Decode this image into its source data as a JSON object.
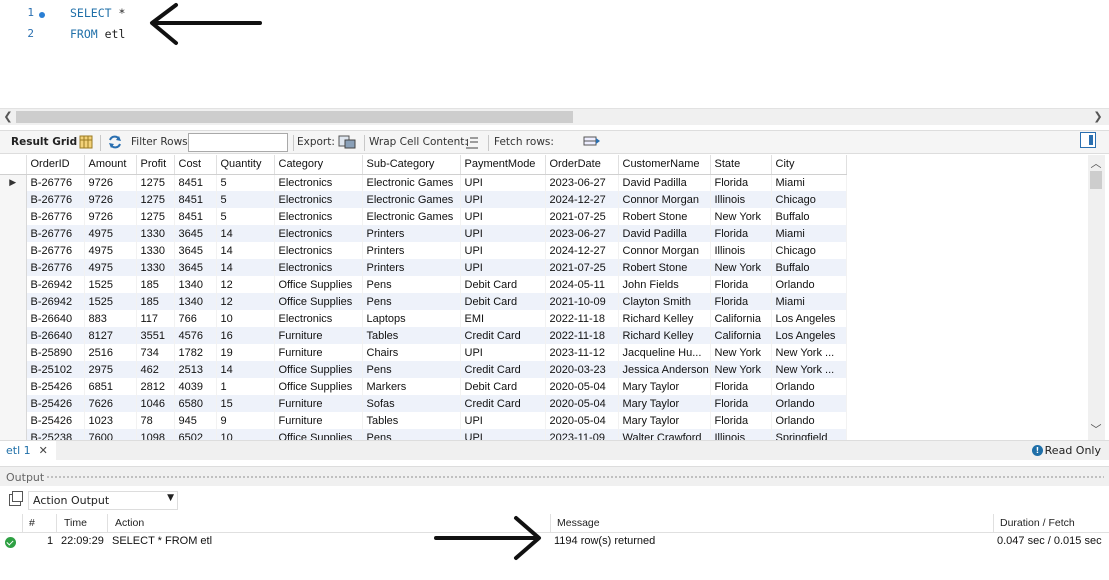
{
  "editor": {
    "lines": [
      {
        "num": "1",
        "keyword": "SELECT",
        "rest": " *"
      },
      {
        "num": "2",
        "keyword": "FROM",
        "rest": " etl"
      }
    ]
  },
  "toolbar": {
    "result_grid": "Result Grid",
    "filter_rows": "Filter Rows:",
    "filter_value": "",
    "export": "Export:",
    "wrap_cell": "Wrap Cell Content:",
    "fetch_rows": "Fetch rows:"
  },
  "grid": {
    "columns": [
      "OrderID",
      "Amount",
      "Profit",
      "Cost",
      "Quantity",
      "Category",
      "Sub-Category",
      "PaymentMode",
      "OrderDate",
      "CustomerName",
      "State",
      "City"
    ],
    "rows": [
      [
        "B-26776",
        "9726",
        "1275",
        "8451",
        "5",
        "Electronics",
        "Electronic Games",
        "UPI",
        "2023-06-27",
        "David Padilla",
        "Florida",
        "Miami"
      ],
      [
        "B-26776",
        "9726",
        "1275",
        "8451",
        "5",
        "Electronics",
        "Electronic Games",
        "UPI",
        "2024-12-27",
        "Connor Morgan",
        "Illinois",
        "Chicago"
      ],
      [
        "B-26776",
        "9726",
        "1275",
        "8451",
        "5",
        "Electronics",
        "Electronic Games",
        "UPI",
        "2021-07-25",
        "Robert Stone",
        "New York",
        "Buffalo"
      ],
      [
        "B-26776",
        "4975",
        "1330",
        "3645",
        "14",
        "Electronics",
        "Printers",
        "UPI",
        "2023-06-27",
        "David Padilla",
        "Florida",
        "Miami"
      ],
      [
        "B-26776",
        "4975",
        "1330",
        "3645",
        "14",
        "Electronics",
        "Printers",
        "UPI",
        "2024-12-27",
        "Connor Morgan",
        "Illinois",
        "Chicago"
      ],
      [
        "B-26776",
        "4975",
        "1330",
        "3645",
        "14",
        "Electronics",
        "Printers",
        "UPI",
        "2021-07-25",
        "Robert Stone",
        "New York",
        "Buffalo"
      ],
      [
        "B-26942",
        "1525",
        "185",
        "1340",
        "12",
        "Office Supplies",
        "Pens",
        "Debit Card",
        "2024-05-11",
        "John Fields",
        "Florida",
        "Orlando"
      ],
      [
        "B-26942",
        "1525",
        "185",
        "1340",
        "12",
        "Office Supplies",
        "Pens",
        "Debit Card",
        "2021-10-09",
        "Clayton Smith",
        "Florida",
        "Miami"
      ],
      [
        "B-26640",
        "883",
        "117",
        "766",
        "10",
        "Electronics",
        "Laptops",
        "EMI",
        "2022-11-18",
        "Richard Kelley",
        "California",
        "Los Angeles"
      ],
      [
        "B-26640",
        "8127",
        "3551",
        "4576",
        "16",
        "Furniture",
        "Tables",
        "Credit Card",
        "2022-11-18",
        "Richard Kelley",
        "California",
        "Los Angeles"
      ],
      [
        "B-25890",
        "2516",
        "734",
        "1782",
        "19",
        "Furniture",
        "Chairs",
        "UPI",
        "2023-11-12",
        "Jacqueline Hu...",
        "New York",
        "New York ..."
      ],
      [
        "B-25102",
        "2975",
        "462",
        "2513",
        "14",
        "Office Supplies",
        "Pens",
        "Credit Card",
        "2020-03-23",
        "Jessica Anderson",
        "New York",
        "New York ..."
      ],
      [
        "B-25426",
        "6851",
        "2812",
        "4039",
        "1",
        "Office Supplies",
        "Markers",
        "Debit Card",
        "2020-05-04",
        "Mary Taylor",
        "Florida",
        "Orlando"
      ],
      [
        "B-25426",
        "7626",
        "1046",
        "6580",
        "15",
        "Furniture",
        "Sofas",
        "Credit Card",
        "2020-05-04",
        "Mary Taylor",
        "Florida",
        "Orlando"
      ],
      [
        "B-25426",
        "1023",
        "78",
        "945",
        "9",
        "Furniture",
        "Tables",
        "UPI",
        "2020-05-04",
        "Mary Taylor",
        "Florida",
        "Orlando"
      ],
      [
        "B-25238",
        "7600",
        "1098",
        "6502",
        "10",
        "Office Supplies",
        "Pens",
        "UPI",
        "2023-11-09",
        "Walter Crawford",
        "Illinois",
        "Springfield"
      ]
    ]
  },
  "tabs": {
    "result_tab": "etl 1",
    "close": "✕",
    "read_only": "Read Only"
  },
  "output": {
    "label": "Output",
    "selector": "Action Output",
    "headers": {
      "num": "#",
      "time": "Time",
      "action": "Action",
      "message": "Message",
      "duration": "Duration / Fetch"
    },
    "row": {
      "num": "1",
      "time": "22:09:29",
      "action": "SELECT * FROM etl",
      "message": "1194 row(s) returned",
      "duration": "0.047 sec / 0.015 sec"
    }
  }
}
